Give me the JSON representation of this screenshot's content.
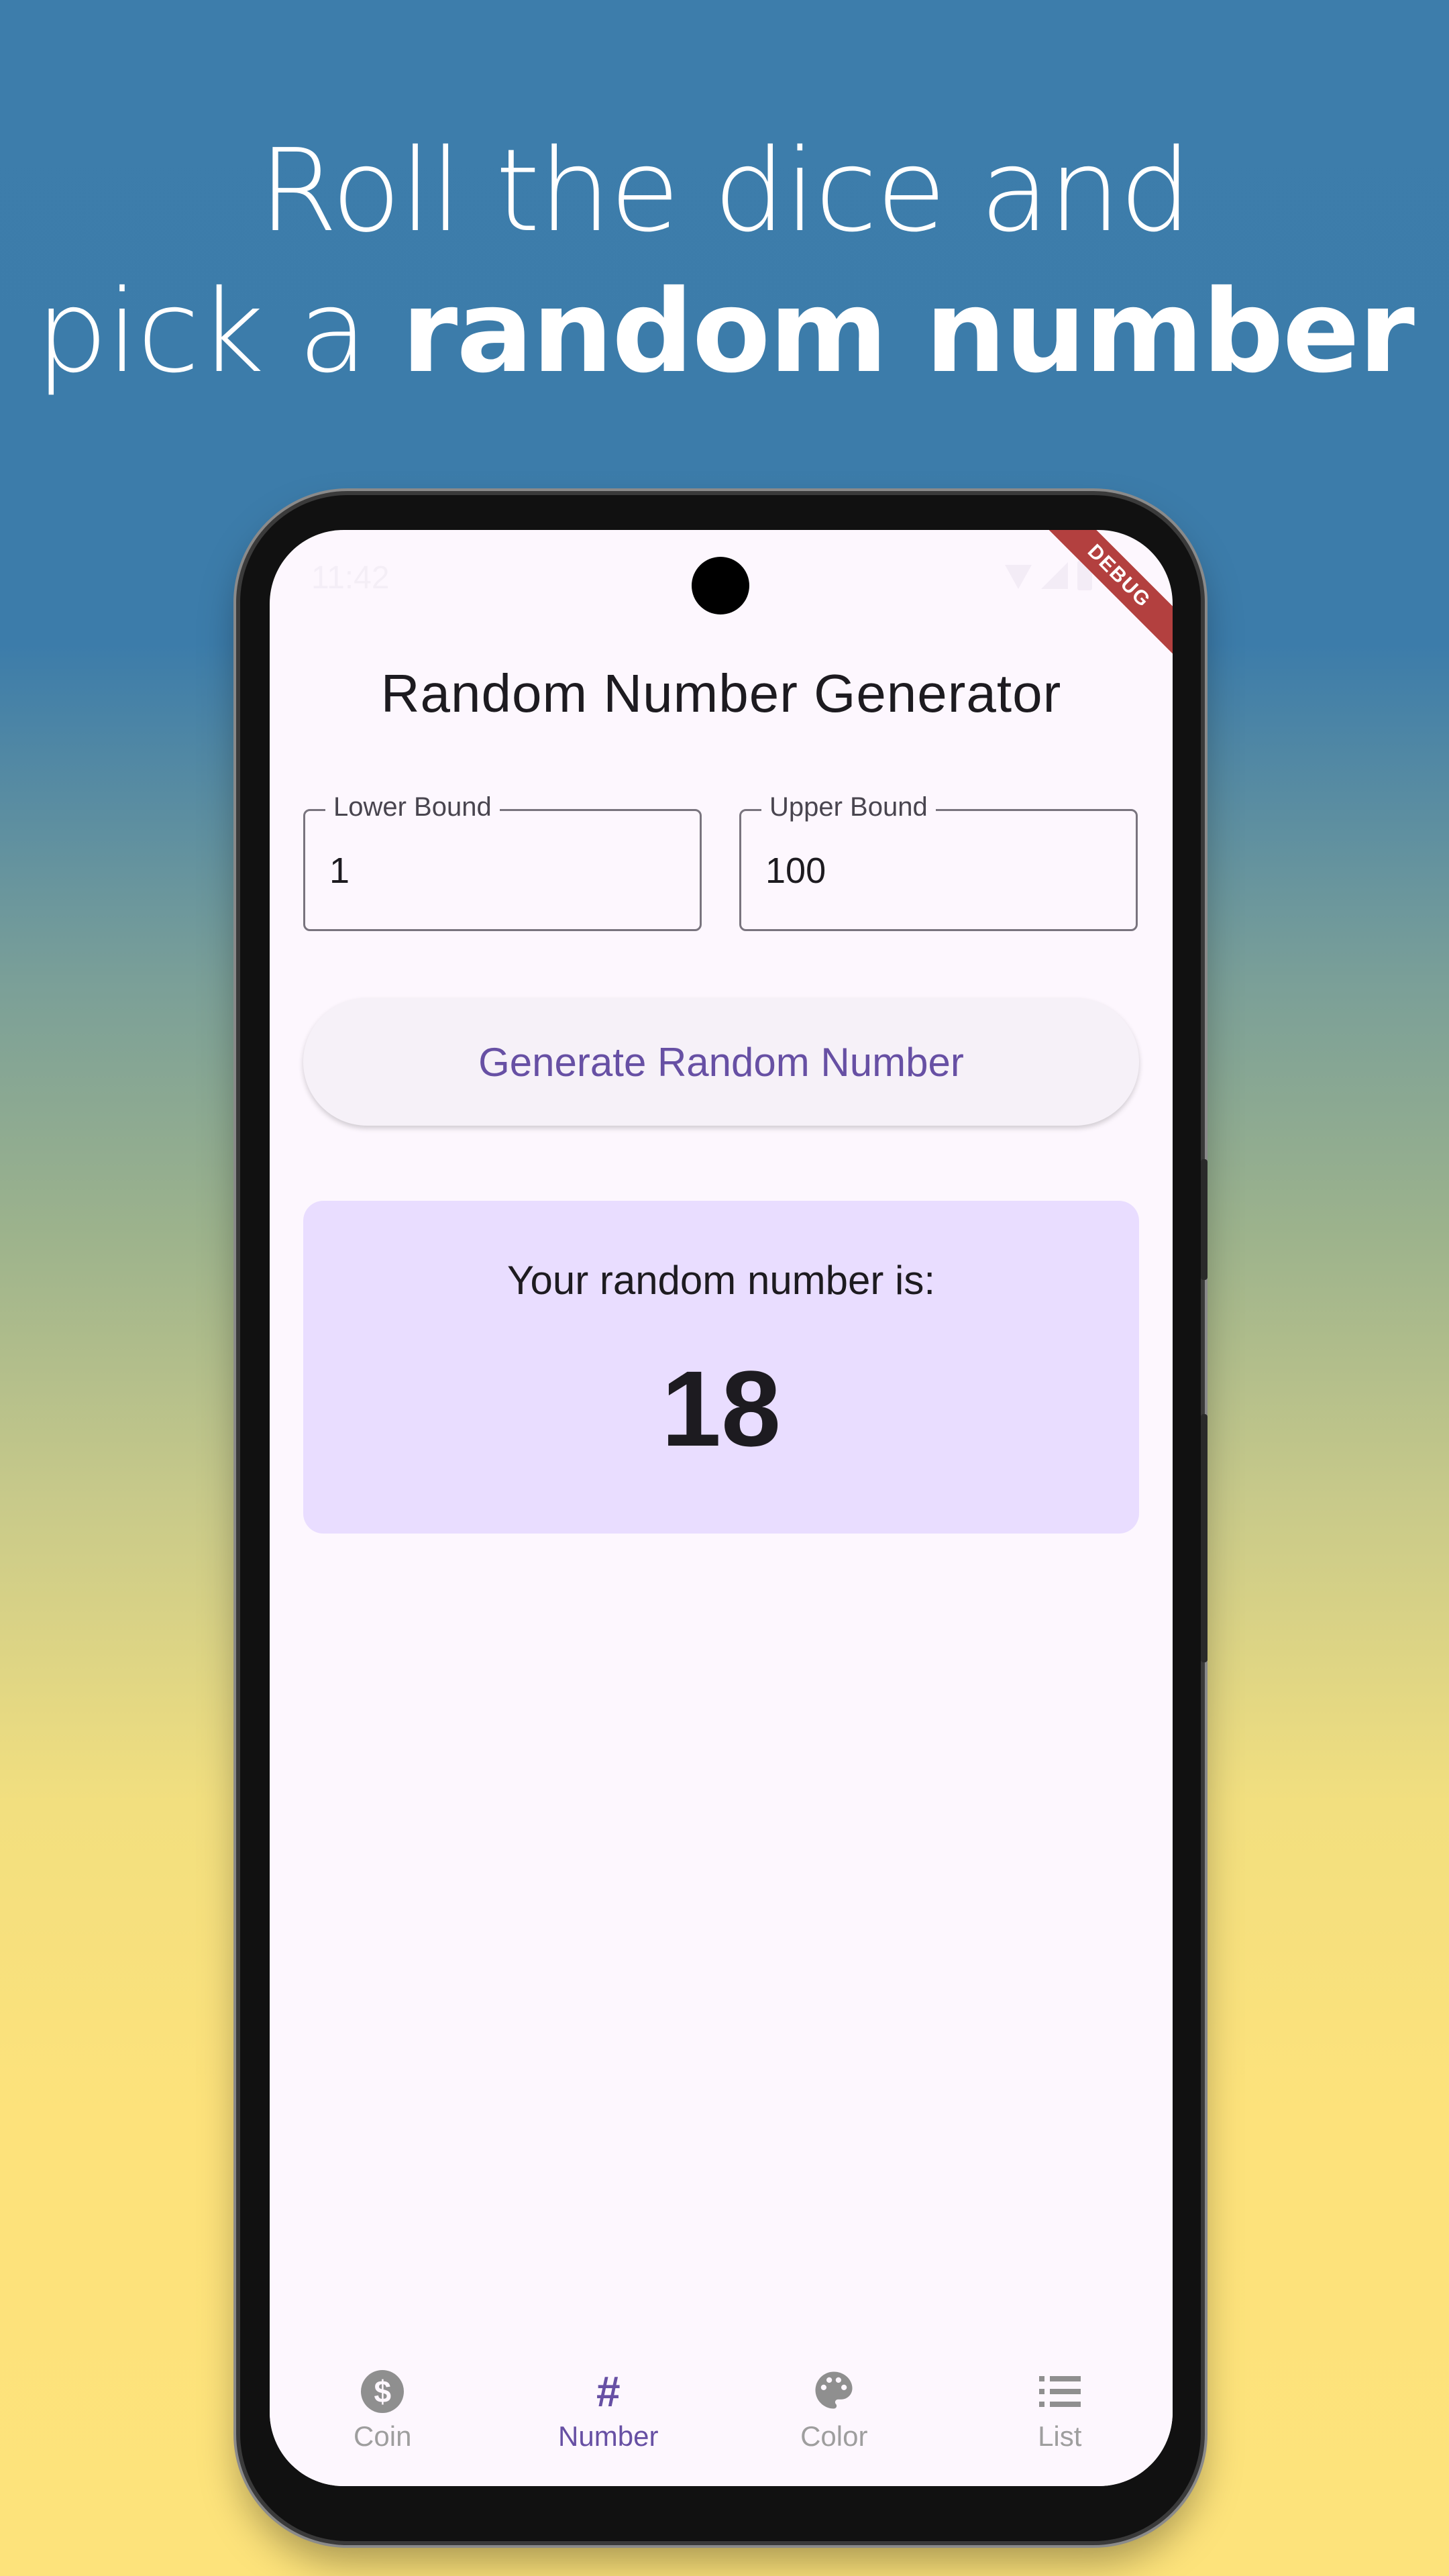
{
  "headline": {
    "line1": "Roll the dice and",
    "line2_prefix": "pick a ",
    "line2_bold": "random number"
  },
  "status_bar": {
    "time": "11:42",
    "debug_banner": "DEBUG"
  },
  "app": {
    "title": "Random Number Generator",
    "lower_bound": {
      "label": "Lower Bound",
      "value": "1"
    },
    "upper_bound": {
      "label": "Upper Bound",
      "value": "100"
    },
    "generate_button": "Generate Random Number",
    "result": {
      "caption": "Your random number is:",
      "value": "18"
    }
  },
  "bottom_nav": {
    "items": [
      {
        "label": "Coin",
        "icon": "dollar-coin-icon",
        "active": false
      },
      {
        "label": "Number",
        "icon": "hash-icon",
        "active": true
      },
      {
        "label": "Color",
        "icon": "palette-icon",
        "active": false
      },
      {
        "label": "List",
        "icon": "list-icon",
        "active": false
      }
    ]
  },
  "colors": {
    "primary": "#6750a4",
    "surface": "#fdf7fe",
    "result_container": "#e9ddff",
    "debug_ribbon": "#b3403f"
  }
}
